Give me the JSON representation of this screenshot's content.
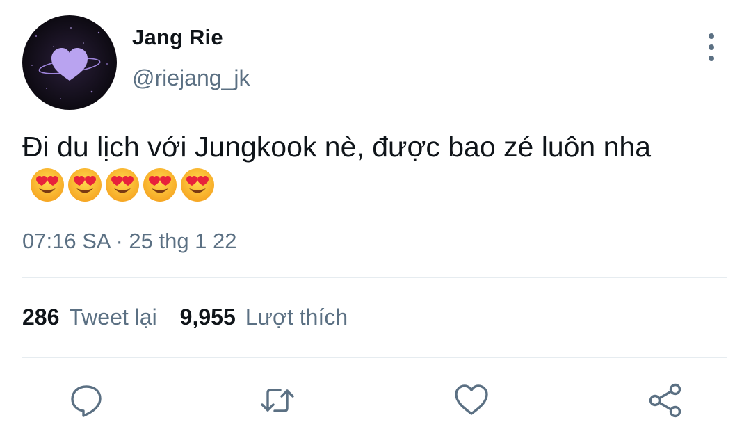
{
  "user": {
    "display_name": "Jang Rie",
    "handle": "@riejang_jk"
  },
  "tweet": {
    "text": "Đi du lịch với Jungkook nè, được bao zé luôn nha",
    "emojis": [
      "heart-eyes",
      "heart-eyes",
      "heart-eyes",
      "heart-eyes",
      "heart-eyes"
    ],
    "timestamp": "07:16 SA · 25 thg 1 22"
  },
  "stats": {
    "retweets_count": "286",
    "retweets_label": "Tweet lại",
    "likes_count": "9,955",
    "likes_label": "Lượt thích"
  },
  "actions": [
    "reply-icon",
    "retweet-icon",
    "like-icon",
    "share-icon"
  ],
  "colors": {
    "secondary_text": "#5b7083",
    "primary_text": "#0f1419",
    "divider": "#e6ecf0",
    "avatar_heart": "#b9a3f0"
  }
}
